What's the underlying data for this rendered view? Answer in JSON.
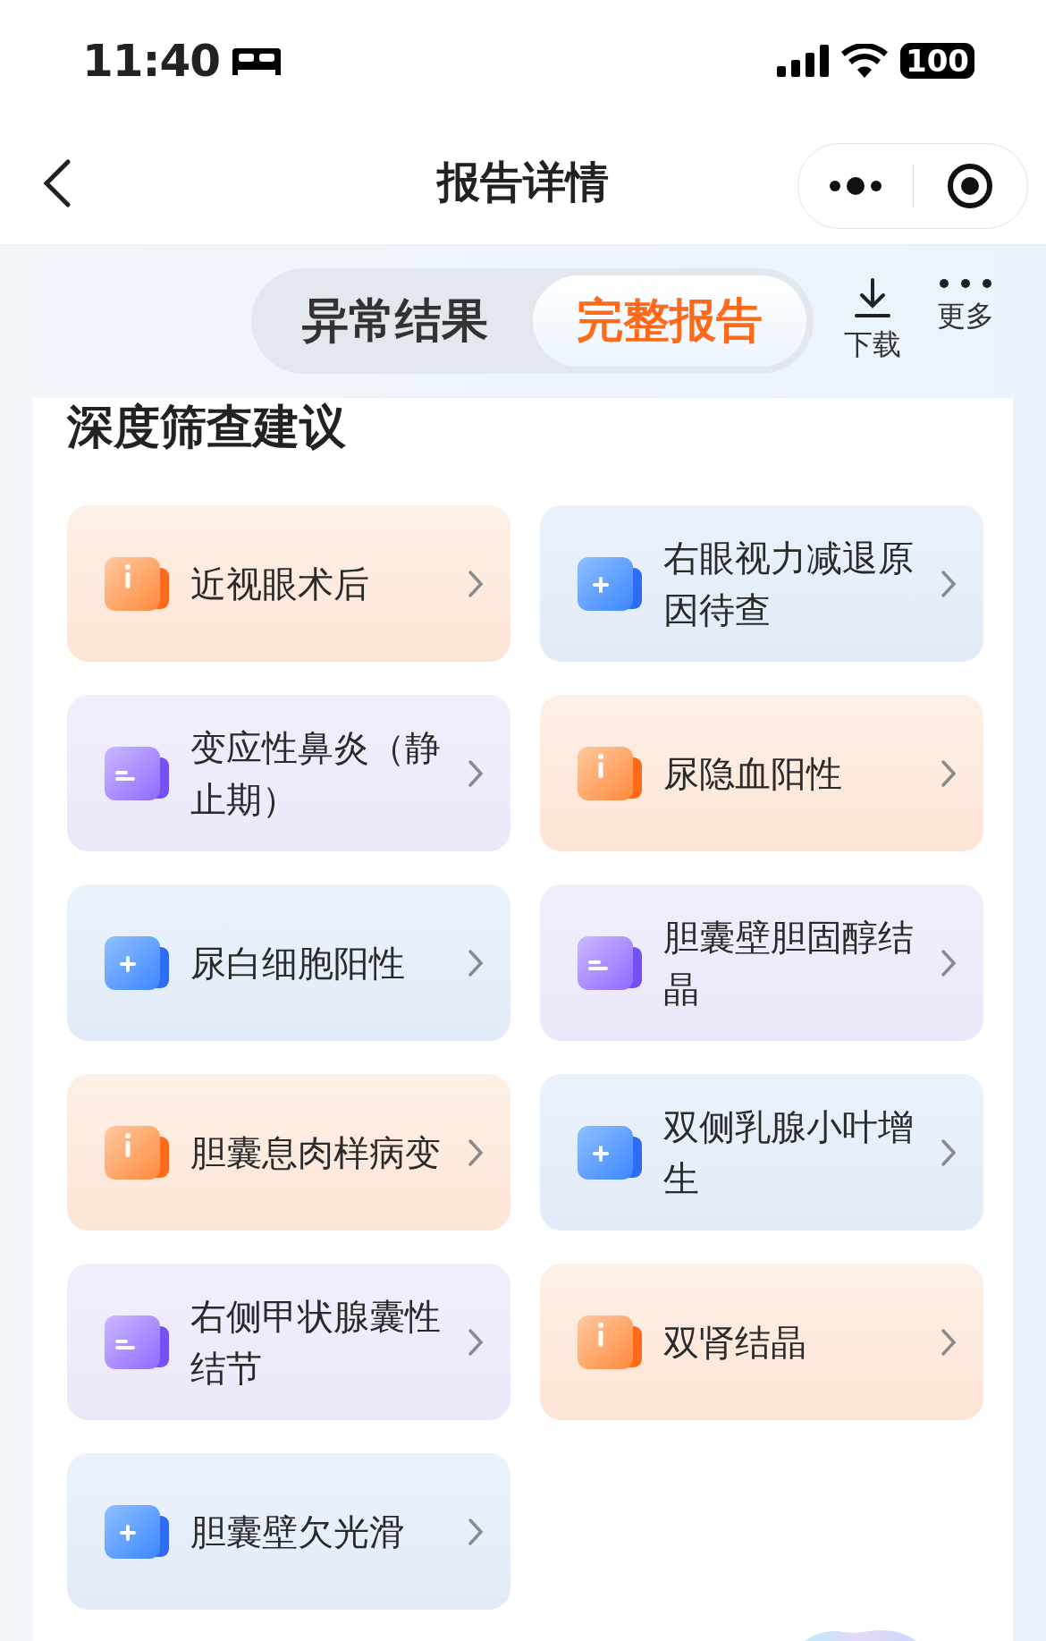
{
  "status_bar": {
    "time": "11:40",
    "battery": "100"
  },
  "nav": {
    "title": "报告详情"
  },
  "tabs": [
    {
      "label": "异常结果",
      "selected": false
    },
    {
      "label": "完整报告",
      "selected": true
    }
  ],
  "actions": [
    {
      "kind": "download",
      "label": "下载"
    },
    {
      "kind": "more",
      "label": "更多"
    }
  ],
  "section": {
    "title": "深度筛查建议",
    "items": [
      {
        "kind": "info",
        "label": "近视眼术后"
      },
      {
        "kind": "plus",
        "label": "右眼视力减退原因待查"
      },
      {
        "kind": "doc",
        "label": "变应性鼻炎（静止期）"
      },
      {
        "kind": "info",
        "label": "尿隐血阳性"
      },
      {
        "kind": "plus",
        "label": "尿白细胞阳性"
      },
      {
        "kind": "doc",
        "label": "胆囊壁胆固醇结晶"
      },
      {
        "kind": "info",
        "label": "胆囊息肉样病变"
      },
      {
        "kind": "plus",
        "label": "双侧乳腺小叶增生"
      },
      {
        "kind": "doc",
        "label": "右侧甲状腺囊性结节"
      },
      {
        "kind": "info",
        "label": "双肾结晶"
      },
      {
        "kind": "plus",
        "label": "胆囊壁欠光滑"
      }
    ]
  }
}
